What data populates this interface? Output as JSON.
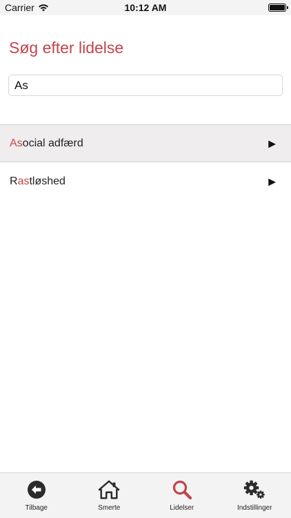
{
  "status_bar": {
    "carrier": "Carrier",
    "time": "10:12 AM"
  },
  "header": {
    "title": "Søg efter lidelse"
  },
  "search": {
    "value": "As",
    "highlight_color": "#c0454b"
  },
  "results": [
    {
      "match": "As",
      "rest": "ocial adfærd",
      "prefix": "",
      "arrow": "▶"
    },
    {
      "prefix": "R",
      "match": "as",
      "rest": "tløshed",
      "arrow": "▶"
    }
  ],
  "tabs": [
    {
      "label": "Tilbage",
      "icon": "back-arrow-icon"
    },
    {
      "label": "Smerte",
      "icon": "home-icon"
    },
    {
      "label": "Lidelser",
      "icon": "search-icon",
      "active_color": "#c0454b"
    },
    {
      "label": "Indstillinger",
      "icon": "gear-icon"
    }
  ]
}
